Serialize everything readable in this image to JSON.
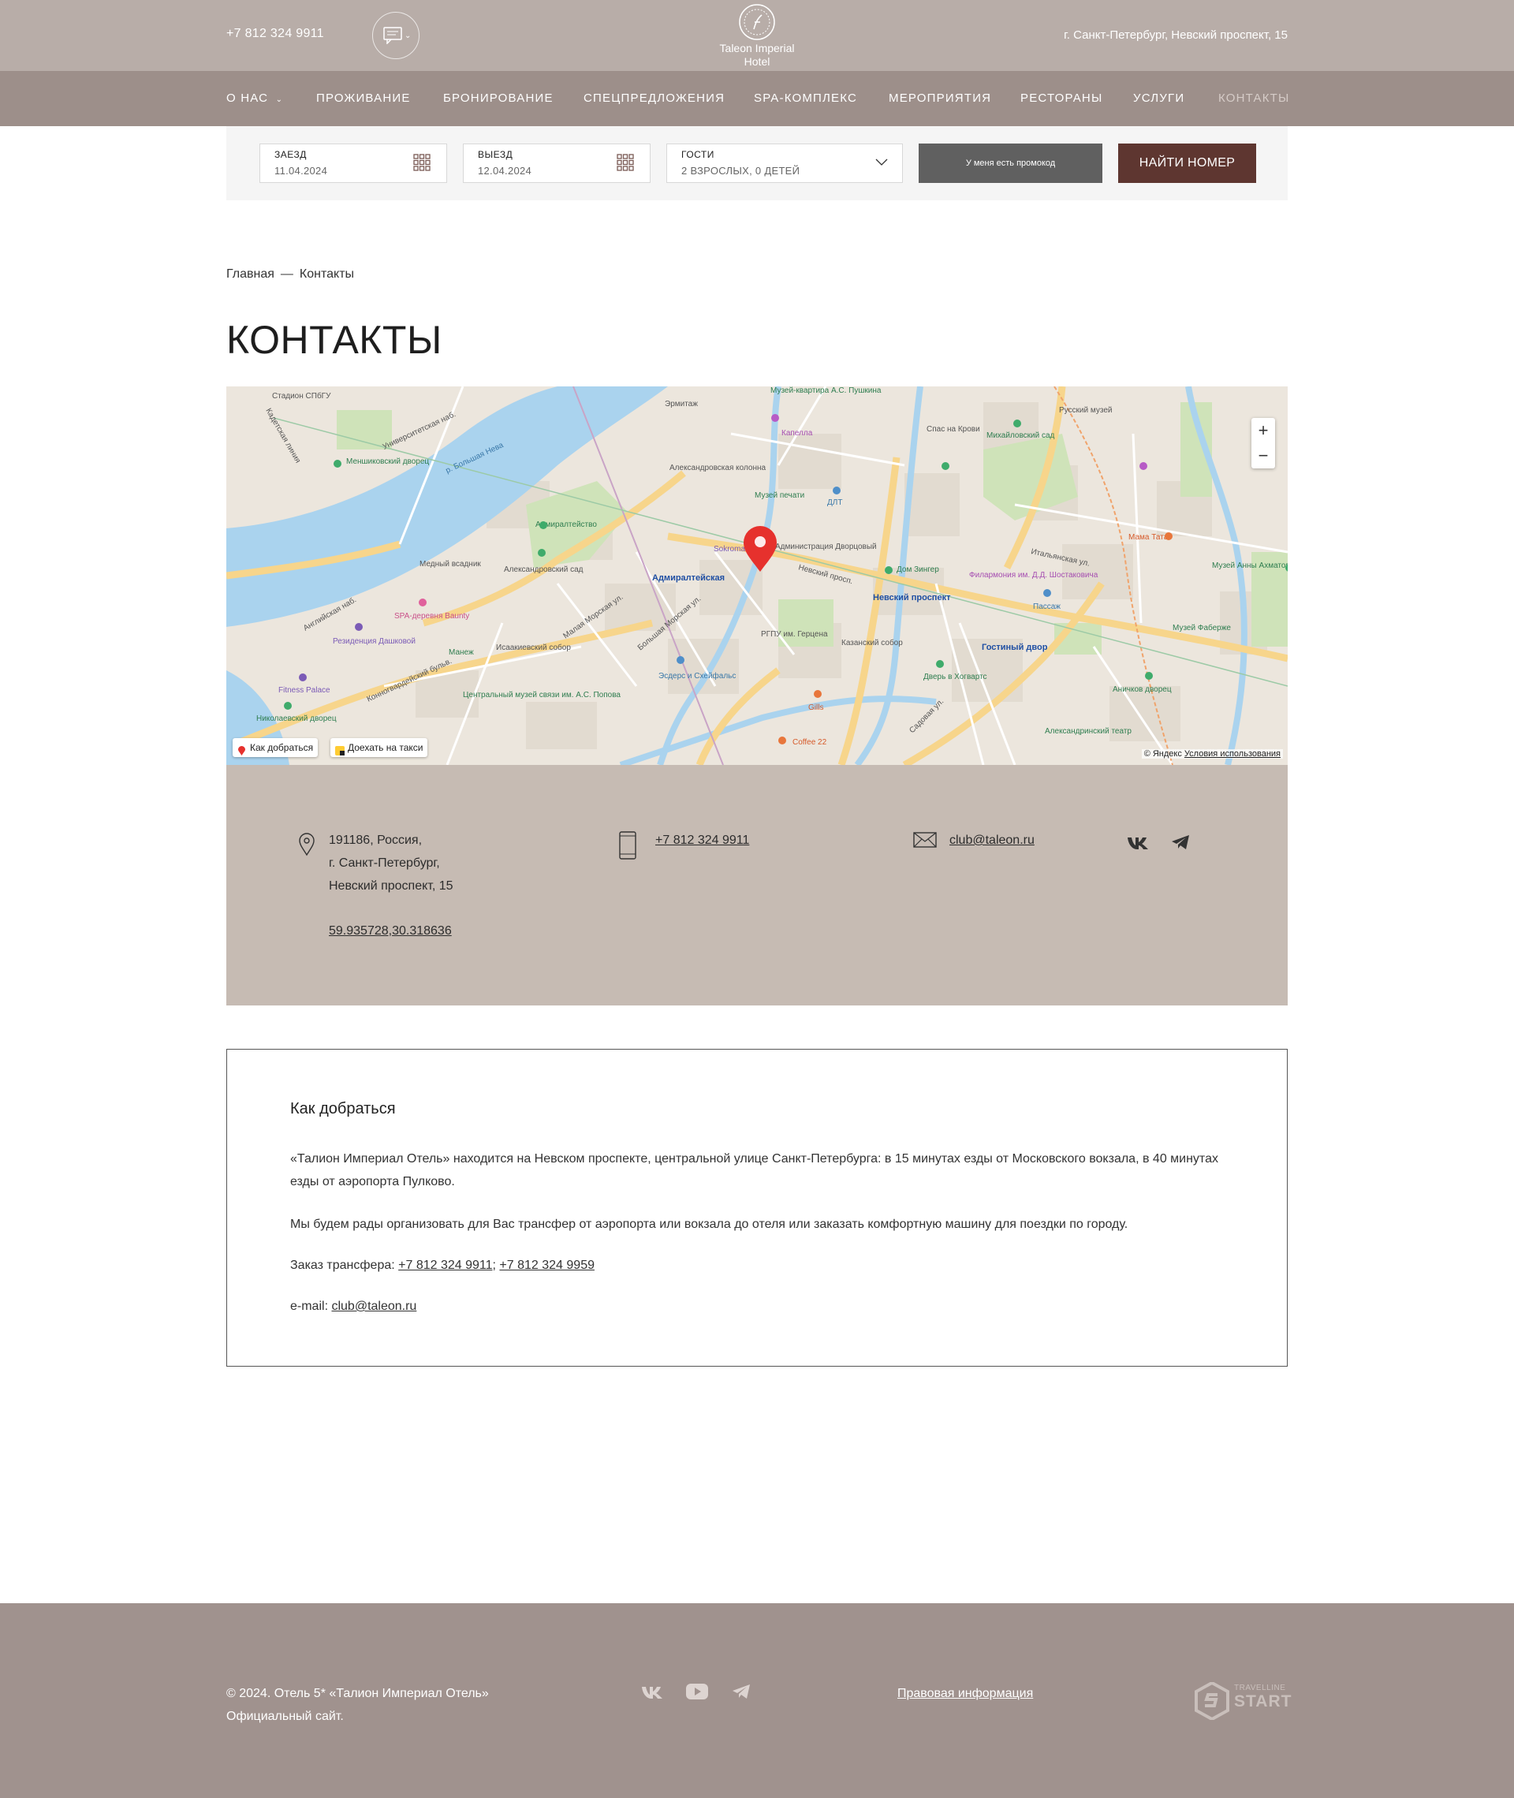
{
  "header": {
    "phone": "+7 812 324 9911",
    "logo_line1": "Taleon Imperial",
    "logo_line2": "Hotel",
    "address": "г. Санкт-Петербург, Невский проспект, 15"
  },
  "nav": [
    {
      "label": "О НАС",
      "dropdown": true
    },
    {
      "label": "ПРОЖИВАНИЕ"
    },
    {
      "label": "БРОНИРОВАНИЕ"
    },
    {
      "label": "СПЕЦПРЕДЛОЖЕНИЯ"
    },
    {
      "label": "SPA-КОМПЛЕКС"
    },
    {
      "label": "МЕРОПРИЯТИЯ"
    },
    {
      "label": "РЕСТОРАНЫ"
    },
    {
      "label": "УСЛУГИ"
    },
    {
      "label": "КОНТАКТЫ",
      "active": true
    }
  ],
  "booking": {
    "checkin_label": "ЗАЕЗД",
    "checkin_value": "11.04.2024",
    "checkout_label": "ВЫЕЗД",
    "checkout_value": "12.04.2024",
    "guests_label": "ГОСТИ",
    "guests_value": "2 ВЗРОСЛЫХ, 0 ДЕТЕЙ",
    "promo_label": "У меня есть промокод",
    "find_label": "НАЙТИ НОМЕР"
  },
  "breadcrumb": {
    "home": "Главная",
    "sep": "—",
    "current": "Контакты"
  },
  "page_title": "КОНТАКТЫ",
  "map": {
    "labels": [
      "Стадион СПбГУ",
      "Университетская наб.",
      "Кадетская линия",
      "Меншиковский дворец",
      "р. Большая Нева",
      "Адмиралтейство",
      "Медный всадник",
      "Александровский сад",
      "Эрмитаж",
      "Александровская колонна",
      "Музей печати",
      "ДЛТ",
      "Капелла",
      "Музей-квартира А.С. Пушкина",
      "Спас на Крови",
      "Михайловский сад",
      "Русский музей",
      "Адмиралтейская",
      "Невский просп.",
      "Невский проспект",
      "Гостиный двор",
      "Исаакиевский собор",
      "SPA-деревня Baunty",
      "Резиденция Дашковой",
      "Манеж",
      "Fitness Palace",
      "Николаевский дворец",
      "Центральный музей связи им. А.С. Попова",
      "Эсдерс и Схейфальс",
      "Дом Зингер",
      "Казанский собор",
      "Филармония им. Д.Д. Шостаковича",
      "Пассаж",
      "Дверь в Хогвартс",
      "Аничков дворец",
      "Александринский театр",
      "Музей Фаберже",
      "Музей Анны Ахматовой",
      "Мама Тата",
      "Gills",
      "Coffee 22",
      "Садовая ул.",
      "Английская наб.",
      "Конногвардейский бульв.",
      "Малая Морская ул.",
      "Большая Морская ул.",
      "Итальянская ул.",
      "РГПУ им. Герцена",
      "Sokroma",
      "Администрация Дворцовый"
    ],
    "route_button": "Как добраться",
    "taxi_button": "Доехать на такси",
    "copyright": "© Яндекс",
    "terms": "Условия использования",
    "zoom_in": "+",
    "zoom_out": "−"
  },
  "contacts": {
    "address_lines": [
      "191186, Россия,",
      "г. Санкт-Петербург,",
      "Невский проспект, 15"
    ],
    "coords": "59.935728,30.318636",
    "phone": "+7 812 324 9911",
    "email": "club@taleon.ru"
  },
  "how_to_get": {
    "title": "Как добраться",
    "p1": "«Талион Империал Отель» находится на Невском проспекте, центральной улице Санкт-Петербурга: в 15 минутах езды от Московского вокзала, в 40 минутах езды от аэропорта Пулково.",
    "p2": "Мы будем рады организовать для Вас трансфер от аэропорта или вокзала до отеля или заказать комфортную машину для поездки по городу.",
    "transfer_label": "Заказ трансфера:",
    "transfer_phone1": "+7 812 324 9911",
    "transfer_phone2": "+7 812 324 9959",
    "email_label": "e-mail:",
    "email": "club@taleon.ru"
  },
  "footer": {
    "copyright_line1": "© 2024. Отель 5* «Талион Империал Отель»",
    "copyright_line2": "Официальный сайт.",
    "legal": "Правовая информация",
    "tl_small": "TRAVELLINE",
    "tl_big": "START"
  }
}
